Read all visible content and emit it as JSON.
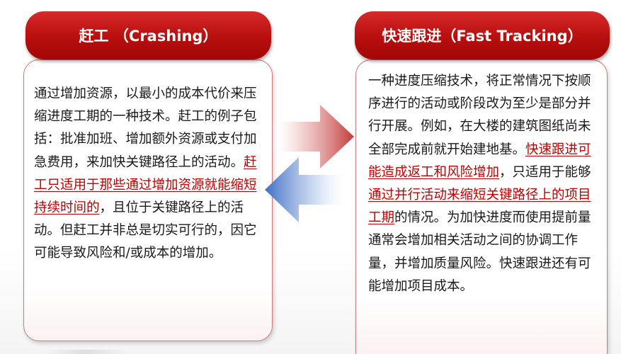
{
  "left_panel": {
    "title": "赶工 （Crashing）",
    "body_before_link": "通过增加资源，以最小的成本代价来压缩进度工期的一种技术。赶工的例子包括：批准加班、增加额外资源或支付加急费用，来加快关键路径上的活动。",
    "link": "赶工只适用于那些通过增加资源就能缩短持续时间的",
    "body_after_link": "，且位于关键路径上的活动。但赶工并非总是切实可行的，因它可能导致风险和/或成本的增加。"
  },
  "right_panel": {
    "title": "快速跟进（Fast Tracking）",
    "body_1": "一种进度压缩技术，将正常情况下按顺序进行的活动或阶段改为至少是部分并行开展。例如，在大楼的建筑图纸尚未全部完成前就开始建地基。",
    "link_1": "快速跟进可能造成返工和风险增加",
    "body_2": "，只适用于能够",
    "link_2": "通过并行活动来缩短关键路径上的项目工期",
    "body_3": "的情况。为加快进度而使用提前量通常会增加相关活动之间的协调工作量，并增加质量风险。快速跟进还有可能增加项目成本。"
  },
  "colors": {
    "tab_red": "#b80e0e",
    "link_red": "#c00000",
    "arrow_red": "#c94a4a",
    "arrow_blue": "#4a78c8"
  },
  "icons": {
    "right_arrow": "arrow-right-icon",
    "left_arrow": "arrow-left-icon"
  }
}
